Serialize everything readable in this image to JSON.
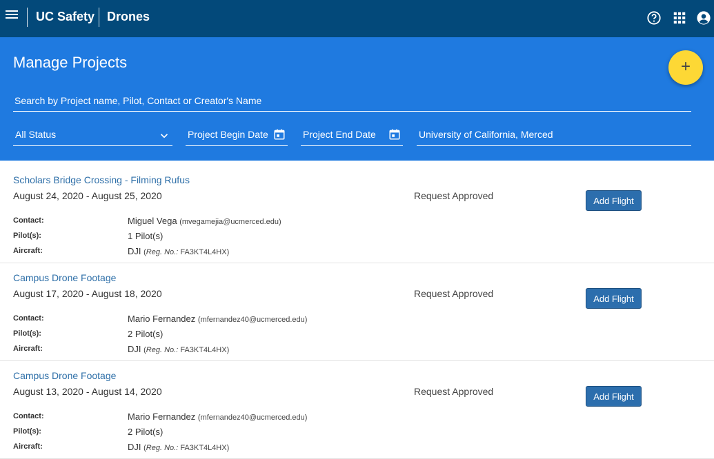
{
  "header": {
    "brand": "UC Safety",
    "app_name": "Drones",
    "icons": [
      "menu-icon",
      "help-icon",
      "apps-grid-icon",
      "account-icon"
    ]
  },
  "banner": {
    "title": "Manage Projects",
    "search_placeholder": "Search by Project name, Pilot, Contact or Creator's Name",
    "status_filter": "All Status",
    "begin_date_label": "Project Begin Date",
    "end_date_label": "Project End Date",
    "campus": "University of California, Merced",
    "fab_label": "+"
  },
  "labels": {
    "contact": "Contact:",
    "pilots": "Pilot(s):",
    "aircraft": "Aircraft:",
    "reg_prefix": "Reg. No.:"
  },
  "projects": [
    {
      "title": "Scholars Bridge Crossing - Filming Rufus",
      "dates": "August 24, 2020 - August 25, 2020",
      "status": "Request Approved",
      "button": "Add Flight",
      "contact_name": "Miguel Vega",
      "contact_email": "(mvegamejia@ucmerced.edu)",
      "pilots": "1 Pilot(s)",
      "aircraft": "DJI",
      "reg_no": "FA3KT4L4HX"
    },
    {
      "title": "Campus Drone Footage",
      "dates": "August 17, 2020 - August 18, 2020",
      "status": "Request Approved",
      "button": "Add Flight",
      "contact_name": "Mario Fernandez",
      "contact_email": "(mfernandez40@ucmerced.edu)",
      "pilots": "2 Pilot(s)",
      "aircraft": "DJI",
      "reg_no": "FA3KT4L4HX"
    },
    {
      "title": "Campus Drone Footage",
      "dates": "August 13, 2020 - August 14, 2020",
      "status": "Request Approved",
      "button": "Add Flight",
      "contact_name": "Mario Fernandez",
      "contact_email": "(mfernandez40@ucmerced.edu)",
      "pilots": "2 Pilot(s)",
      "aircraft": "DJI",
      "reg_no": "FA3KT4L4HX"
    }
  ],
  "colors": {
    "header_bg": "#03497a",
    "banner_bg": "#1f7ae0",
    "fab_bg": "#fdd835",
    "link": "#2e6fa8",
    "button_bg": "#2c6ead"
  }
}
